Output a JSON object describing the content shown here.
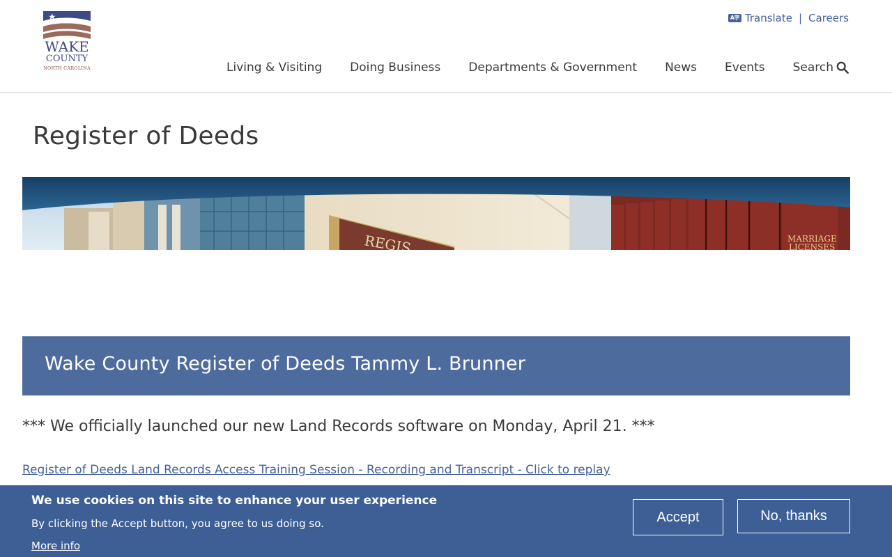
{
  "logo": {
    "line1": "WAKE",
    "line2": "COUNTY",
    "line3": "NORTH CAROLINA"
  },
  "utility_nav": {
    "translate": "Translate",
    "separator": "|",
    "careers": "Careers"
  },
  "main_nav": {
    "items": [
      "Living & Visiting",
      "Doing Business",
      "Departments & Government",
      "News",
      "Events"
    ],
    "search": "Search"
  },
  "page": {
    "title": "Register of Deeds"
  },
  "banner": {
    "sign_text": "REGIS",
    "book_label_1": "MARRIAGE",
    "book_label_2": "LICENSES"
  },
  "section": {
    "heading": "Wake County Register of Deeds Tammy L. Brunner",
    "announcement": "*** We officially launched our new Land Records software on Monday, April 21. ***",
    "link": "Register of Deeds Land Records Access Training Session - Recording and Transcript - Click to replay"
  },
  "cookie": {
    "title": "We use cookies on this site to enhance your user experience",
    "text": "By clicking the Accept button, you agree to us doing so.",
    "more_info": "More info",
    "accept": "Accept",
    "decline": "No, thanks"
  },
  "colors": {
    "brand_blue": "#44629a",
    "section_header": "#4e6b9e",
    "cookie_bar": "#3d5f96"
  }
}
